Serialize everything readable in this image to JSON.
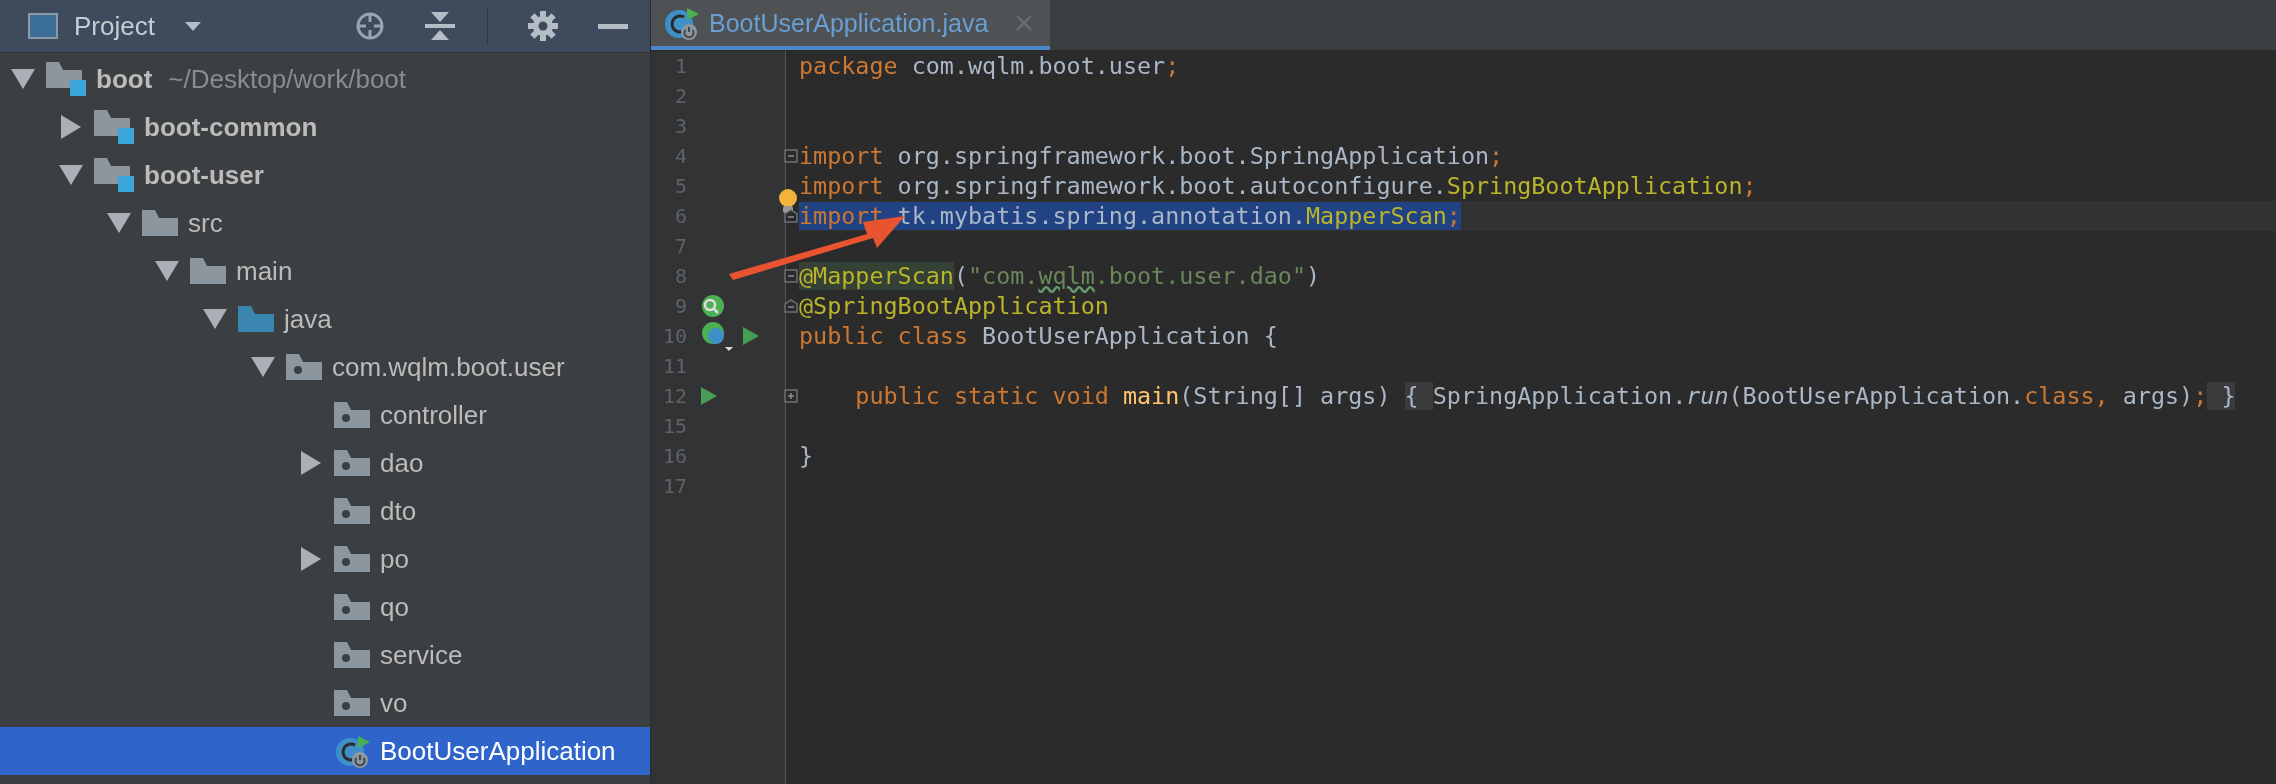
{
  "project_panel": {
    "title": "Project"
  },
  "tree": [
    {
      "label": "boot",
      "path": "~/Desktop/work/boot",
      "kind": "module",
      "expanded": true,
      "selected": false,
      "children": [
        {
          "label": "boot-common",
          "kind": "module",
          "expanded": false,
          "selected": false
        },
        {
          "label": "boot-user",
          "kind": "module",
          "expanded": true,
          "selected": false,
          "children": [
            {
              "label": "src",
              "kind": "folder",
              "expanded": true,
              "selected": false,
              "children": [
                {
                  "label": "main",
                  "kind": "folder",
                  "expanded": true,
                  "selected": false,
                  "children": [
                    {
                      "label": "java",
                      "kind": "source",
                      "expanded": true,
                      "selected": false,
                      "children": [
                        {
                          "label": "com.wqlm.boot.user",
                          "kind": "package",
                          "expanded": true,
                          "selected": false,
                          "children": [
                            {
                              "label": "controller",
                              "kind": "package",
                              "selected": false
                            },
                            {
                              "label": "dao",
                              "kind": "package",
                              "expanded": false,
                              "selected": false
                            },
                            {
                              "label": "dto",
                              "kind": "package",
                              "selected": false
                            },
                            {
                              "label": "po",
                              "kind": "package",
                              "expanded": false,
                              "selected": false
                            },
                            {
                              "label": "qo",
                              "kind": "package",
                              "selected": false
                            },
                            {
                              "label": "service",
                              "kind": "package",
                              "selected": false
                            },
                            {
                              "label": "vo",
                              "kind": "package",
                              "selected": false
                            },
                            {
                              "label": "BootUserApplication",
                              "kind": "class",
                              "selected": true
                            }
                          ]
                        }
                      ]
                    }
                  ]
                }
              ]
            }
          ]
        }
      ]
    }
  ],
  "editor": {
    "tab": {
      "label": "BootUserApplication.java",
      "selected": true
    },
    "lines": [
      {
        "number": "1",
        "current": false,
        "selected": false,
        "bulb": false,
        "run": false,
        "tokens": [
          {
            "kind": "keyword",
            "text": "package"
          },
          {
            "kind": "plain",
            "text": " com.wqlm.boot.user"
          },
          {
            "kind": "keyword",
            "text": ";"
          }
        ]
      },
      {
        "number": "2",
        "current": false,
        "selected": false,
        "bulb": false,
        "run": false
      },
      {
        "number": "3",
        "current": false,
        "selected": false,
        "bulb": false,
        "run": false
      },
      {
        "number": "4",
        "current": false,
        "selected": false,
        "bulb": false,
        "run": false,
        "fold": {
          "kind": "open"
        },
        "tokens": [
          {
            "kind": "keyword",
            "text": "import"
          },
          {
            "kind": "plain",
            "text": " org.springframework.boot.SpringApplication"
          },
          {
            "kind": "keyword",
            "text": ";"
          }
        ]
      },
      {
        "number": "5",
        "current": false,
        "selected": false,
        "bulb": true,
        "run": false,
        "tokens": [
          {
            "kind": "keyword",
            "text": "import"
          },
          {
            "kind": "plain",
            "text": " org.springframework.boot.autoconfigure."
          },
          {
            "kind": "annotation",
            "text": "SpringBootApplication"
          },
          {
            "kind": "keyword",
            "text": ";"
          }
        ]
      },
      {
        "number": "6",
        "current": true,
        "selected": true,
        "bulb": false,
        "run": false,
        "fold": {
          "kind": "close"
        },
        "tokens": [
          {
            "kind": "keyword",
            "text": "import"
          },
          {
            "kind": "plain",
            "text": " tk.mybatis.spring.annotation."
          },
          {
            "kind": "annotation",
            "text": "MapperScan"
          },
          {
            "kind": "keyword",
            "text": ";"
          }
        ]
      },
      {
        "number": "7",
        "current": false,
        "selected": false,
        "bulb": false,
        "run": false
      },
      {
        "number": "8",
        "current": false,
        "selected": false,
        "bulb": false,
        "run": false,
        "fold": {
          "kind": "open"
        },
        "tokens": [
          {
            "kind": "annotation-marked",
            "text": "@MapperScan"
          },
          {
            "kind": "plain",
            "text": "("
          },
          {
            "kind": "string",
            "text": "\"com."
          },
          {
            "kind": "string-typo",
            "text": "wqlm"
          },
          {
            "kind": "string",
            "text": ".boot.user.dao\""
          },
          {
            "kind": "plain",
            "text": ")"
          }
        ]
      },
      {
        "number": "9",
        "current": false,
        "selected": false,
        "bulb": false,
        "run": false,
        "fold": {
          "kind": "close"
        },
        "gutter_icon": {
          "kind": "bean-search"
        },
        "tokens": [
          {
            "kind": "annotation",
            "text": "@SpringBootApplication"
          }
        ]
      },
      {
        "number": "10",
        "current": false,
        "selected": false,
        "bulb": false,
        "run": true,
        "gutter_icon": {
          "kind": "bean-class"
        },
        "tokens": [
          {
            "kind": "keyword",
            "text": "public class"
          },
          {
            "kind": "plain",
            "text": " BootUserApplication {"
          }
        ]
      },
      {
        "number": "11",
        "current": false,
        "selected": false,
        "bulb": false,
        "run": false
      },
      {
        "number": "12",
        "current": false,
        "selected": false,
        "bulb": false,
        "run": true,
        "fold": {
          "kind": "collapsed"
        },
        "tokens": [
          {
            "kind": "keyword",
            "text": "    public static void"
          },
          {
            "kind": "method",
            "text": " main"
          },
          {
            "kind": "plain",
            "text": "(String[] args) "
          },
          {
            "kind": "folded",
            "text": "{ "
          },
          {
            "kind": "plain",
            "text": "SpringApplication."
          },
          {
            "kind": "italic",
            "text": "run"
          },
          {
            "kind": "plain",
            "text": "(BootUserApplication."
          },
          {
            "kind": "keyword",
            "text": "class,"
          },
          {
            "kind": "plain",
            "text": " args)"
          },
          {
            "kind": "keyword",
            "text": ";"
          },
          {
            "kind": "folded",
            "text": " }"
          }
        ]
      },
      {
        "number": "15",
        "current": false,
        "selected": false,
        "bulb": false,
        "run": false
      },
      {
        "number": "16",
        "current": false,
        "selected": false,
        "bulb": false,
        "run": false,
        "tokens": [
          {
            "kind": "plain",
            "text": "}"
          }
        ]
      },
      {
        "number": "17",
        "current": false,
        "selected": false,
        "bulb": false,
        "run": false
      }
    ]
  }
}
